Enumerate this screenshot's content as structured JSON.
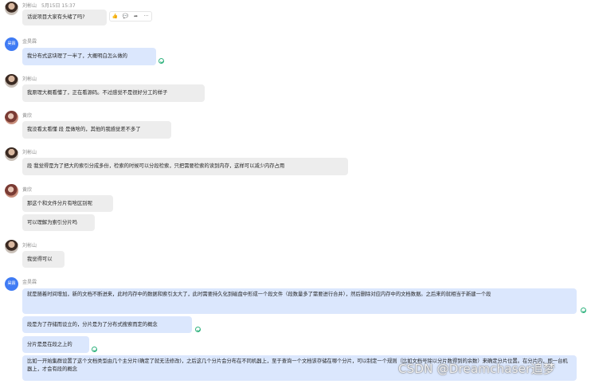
{
  "messages": [
    {
      "sender": "刘彬山",
      "time": "5月15日 15:37",
      "text": "话说项目大家有头绪了吗?"
    },
    {
      "sender": "金昊霖",
      "text": "我分布式这块理了一半了，大概明白怎么做的"
    },
    {
      "sender": "刘彬山",
      "text": "我原理大概看懂了，正在看源码。不过感觉不是很好分工的样子"
    },
    {
      "sender": "黄欣",
      "text": "我没看太看懂 段 是做啥的，其他的我感觉差不多了"
    },
    {
      "sender": "刘彬山",
      "text": "段 我觉得是为了把大的索引分成多份，检索的时候可以分段检索，只把需要检索的读到内存，这样可以减少内存占用"
    },
    {
      "sender": "黄欣",
      "text": "那这个和文件分片有啥区别呢"
    },
    {
      "text": "可以理解为索引分片吗"
    },
    {
      "sender": "刘彬山",
      "text": "我觉得可以"
    },
    {
      "sender": "金昊霖",
      "text": "就是随着时间增加，新的文档不断进来，此时内存中的数据和索引太大了，此时需要持久化到磁盘中形成一个段文件（段数量多了需要进行合并），然后删除对应内存中的文档数据。之后来的就相当于新建一个段"
    },
    {
      "text": "段是为了存储而设立的，分片是为了分布式搜索而定的概念"
    },
    {
      "text": "分片是是在段之上的"
    },
    {
      "text": "比如一开始集群设置了这个文档类型由几个主分片(确定了就无法修改)，之后这几个分片会分布在不同机器上，至于查询一个文档该存储在哪个分片，可以制定一个规则（比如文档号除以分片数得到的余数）来确定分片位置。在分片内，即一台机器上，才会有段的概念"
    }
  ],
  "avatars": {
    "jin": "昊霖"
  },
  "toolbar": {
    "like": "👍",
    "comment": "💬",
    "share": "➦",
    "more": "···"
  },
  "watermark": "CSDN @Dreamchaser追梦"
}
